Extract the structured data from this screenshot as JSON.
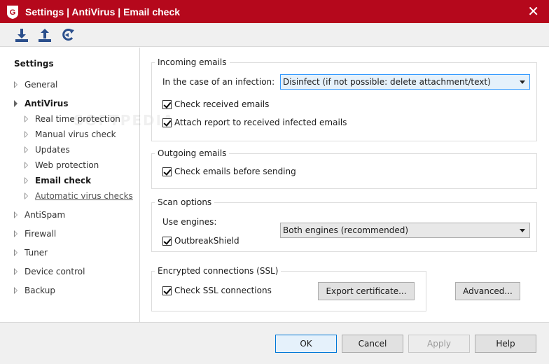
{
  "window": {
    "title": "Settings | AntiVirus | Email check"
  },
  "toolbar": {
    "icons": [
      "import-icon",
      "export-icon",
      "reset-icon"
    ]
  },
  "sidebar": {
    "heading": "Settings",
    "items": [
      {
        "label": "General",
        "level": 0,
        "state": "collapsed"
      },
      {
        "label": "AntiVirus",
        "level": 0,
        "state": "expanded"
      },
      {
        "label": "Real time protection",
        "level": 1
      },
      {
        "label": "Manual virus check",
        "level": 1
      },
      {
        "label": "Updates",
        "level": 1
      },
      {
        "label": "Web protection",
        "level": 1
      },
      {
        "label": "Email check",
        "level": 1,
        "selected": true
      },
      {
        "label": "Automatic virus checks",
        "level": 1,
        "hover": true
      },
      {
        "label": "AntiSpam",
        "level": 0,
        "state": "collapsed"
      },
      {
        "label": "Firewall",
        "level": 0,
        "state": "collapsed"
      },
      {
        "label": "Tuner",
        "level": 0,
        "state": "collapsed"
      },
      {
        "label": "Device control",
        "level": 0,
        "state": "collapsed"
      },
      {
        "label": "Backup",
        "level": 0,
        "state": "collapsed"
      }
    ]
  },
  "incoming": {
    "legend": "Incoming emails",
    "infection_label": "In the case of an infection:",
    "infection_value": "Disinfect (if not possible: delete attachment/text)",
    "check_received": {
      "label": "Check received emails",
      "checked": true
    },
    "attach_report": {
      "label": "Attach report to received infected emails",
      "checked": true
    }
  },
  "outgoing": {
    "legend": "Outgoing emails",
    "check_before_sending": {
      "label": "Check emails before sending",
      "checked": true
    }
  },
  "scan": {
    "legend": "Scan options",
    "engines_label": "Use engines:",
    "engines_value": "Both engines (recommended)",
    "outbreakshield": {
      "label": "OutbreakShield",
      "checked": true
    }
  },
  "ssl": {
    "legend": "Encrypted connections (SSL)",
    "check_ssl": {
      "label": "Check SSL connections",
      "checked": true
    },
    "export_button": "Export certificate...",
    "advanced_button": "Advanced..."
  },
  "buttons": {
    "ok": "OK",
    "cancel": "Cancel",
    "apply": "Apply",
    "help": "Help"
  },
  "watermark": "SOFTPEDIA",
  "colors": {
    "titlebar": "#b5081c",
    "toolbar_icon": "#2b4f8c"
  }
}
